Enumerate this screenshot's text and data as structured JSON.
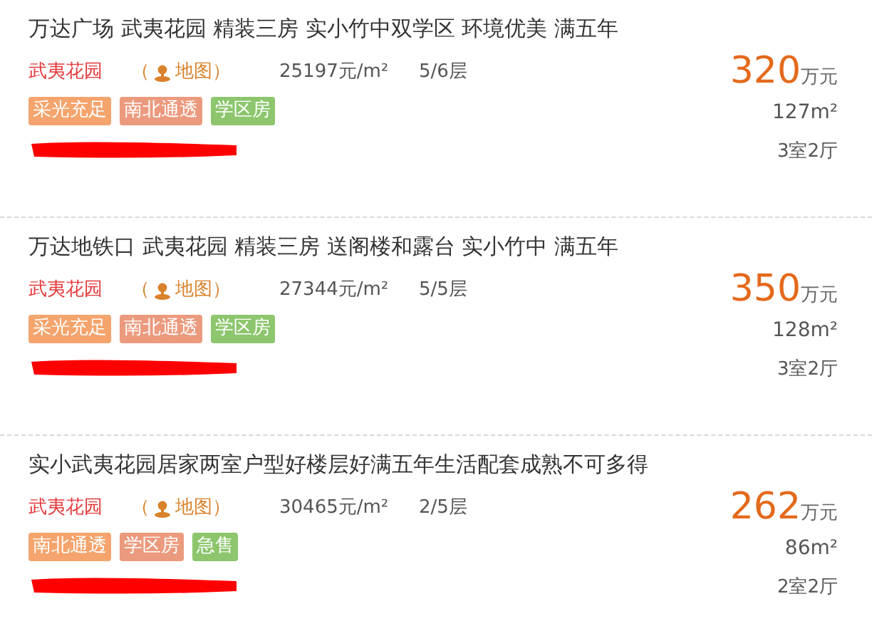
{
  "listings": [
    {
      "title": "万达广场 武夷花园 精装三房 实小竹中双学区 环境优美 满五年",
      "community": "武夷花园",
      "map_link": "（",
      "map_label": "地图）",
      "unit_price": "25197元/m²",
      "floor": "5/6层",
      "tags": [
        {
          "label": "采光充足",
          "color": "#f4a46c"
        },
        {
          "label": "南北通透",
          "color": "#ec9a7e"
        },
        {
          "label": "学区房",
          "color": "#8dc66d"
        }
      ],
      "price": "320",
      "price_unit": "万元",
      "area": "127m²",
      "layout": "3室2厅"
    },
    {
      "title": "万达地铁口 武夷花园 精装三房 送阁楼和露台 实小竹中 满五年",
      "community": "武夷花园",
      "map_link": "（",
      "map_label": "地图）",
      "unit_price": "27344元/m²",
      "floor": "5/5层",
      "tags": [
        {
          "label": "采光充足",
          "color": "#f4a46c"
        },
        {
          "label": "南北通透",
          "color": "#ec9a7e"
        },
        {
          "label": "学区房",
          "color": "#8dc66d"
        }
      ],
      "price": "350",
      "price_unit": "万元",
      "area": "128m²",
      "layout": "3室2厅"
    },
    {
      "title": "实小武夷花园居家两室户型好楼层好满五年生活配套成熟不可多得",
      "community": "武夷花园",
      "map_link": "（",
      "map_label": "地图）",
      "unit_price": "30465元/m²",
      "floor": "2/5层",
      "tags": [
        {
          "label": "南北通透",
          "color": "#f4a46c"
        },
        {
          "label": "学区房",
          "color": "#ec9a7e"
        },
        {
          "label": "急售",
          "color": "#8dc66d"
        }
      ],
      "price": "262",
      "price_unit": "万元",
      "area": "86m²",
      "layout": "2室2厅"
    }
  ]
}
